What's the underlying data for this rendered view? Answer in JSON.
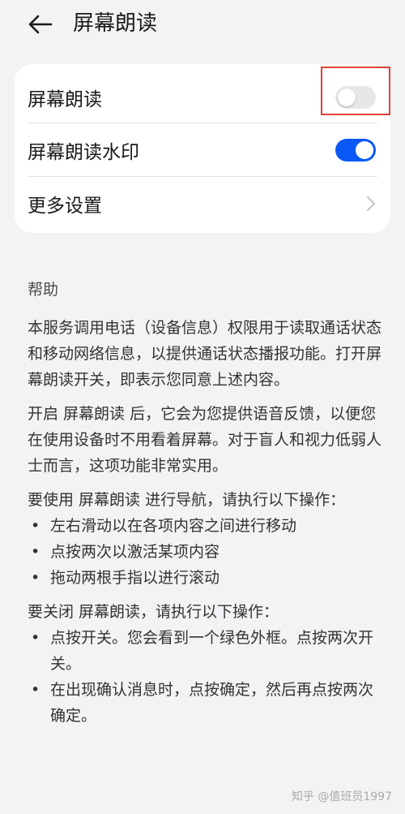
{
  "header": {
    "title": "屏幕朗读",
    "back_icon": "arrow-left-icon"
  },
  "settings": {
    "items": [
      {
        "label": "屏幕朗读",
        "control": "toggle",
        "checked": false
      },
      {
        "label": "屏幕朗读水印",
        "control": "toggle",
        "checked": true
      },
      {
        "label": "更多设置",
        "control": "chevron"
      }
    ],
    "accent_color": "#0a59f7",
    "highlight_color": "#e0413a"
  },
  "help": {
    "title": "帮助",
    "paragraph1": "本服务调用电话（设备信息）权限用于读取通话状态和移动网络信息，以提供通话状态播报功能。打开屏幕朗读开关，即表示您同意上述内容。",
    "paragraph2": "开启 屏幕朗读 后，它会为您提供语音反馈，以便您在使用设备时不用看着屏幕。对于盲人和视力低弱人士而言，这项功能非常实用。",
    "paragraph3": "要使用 屏幕朗读 进行导航，请执行以下操作：",
    "nav_steps": [
      "左右滑动以在各项内容之间进行移动",
      "点按两次以激活某项内容",
      "拖动两根手指以进行滚动"
    ],
    "paragraph4": "要关闭 屏幕朗读，请执行以下操作：",
    "off_steps": [
      "点按开关。您会看到一个绿色外框。点按两次开关。",
      "在出现确认消息时，点按确定，然后再点按两次确定。"
    ],
    "bullet": "•"
  },
  "watermark": "知乎 @值班员1997"
}
